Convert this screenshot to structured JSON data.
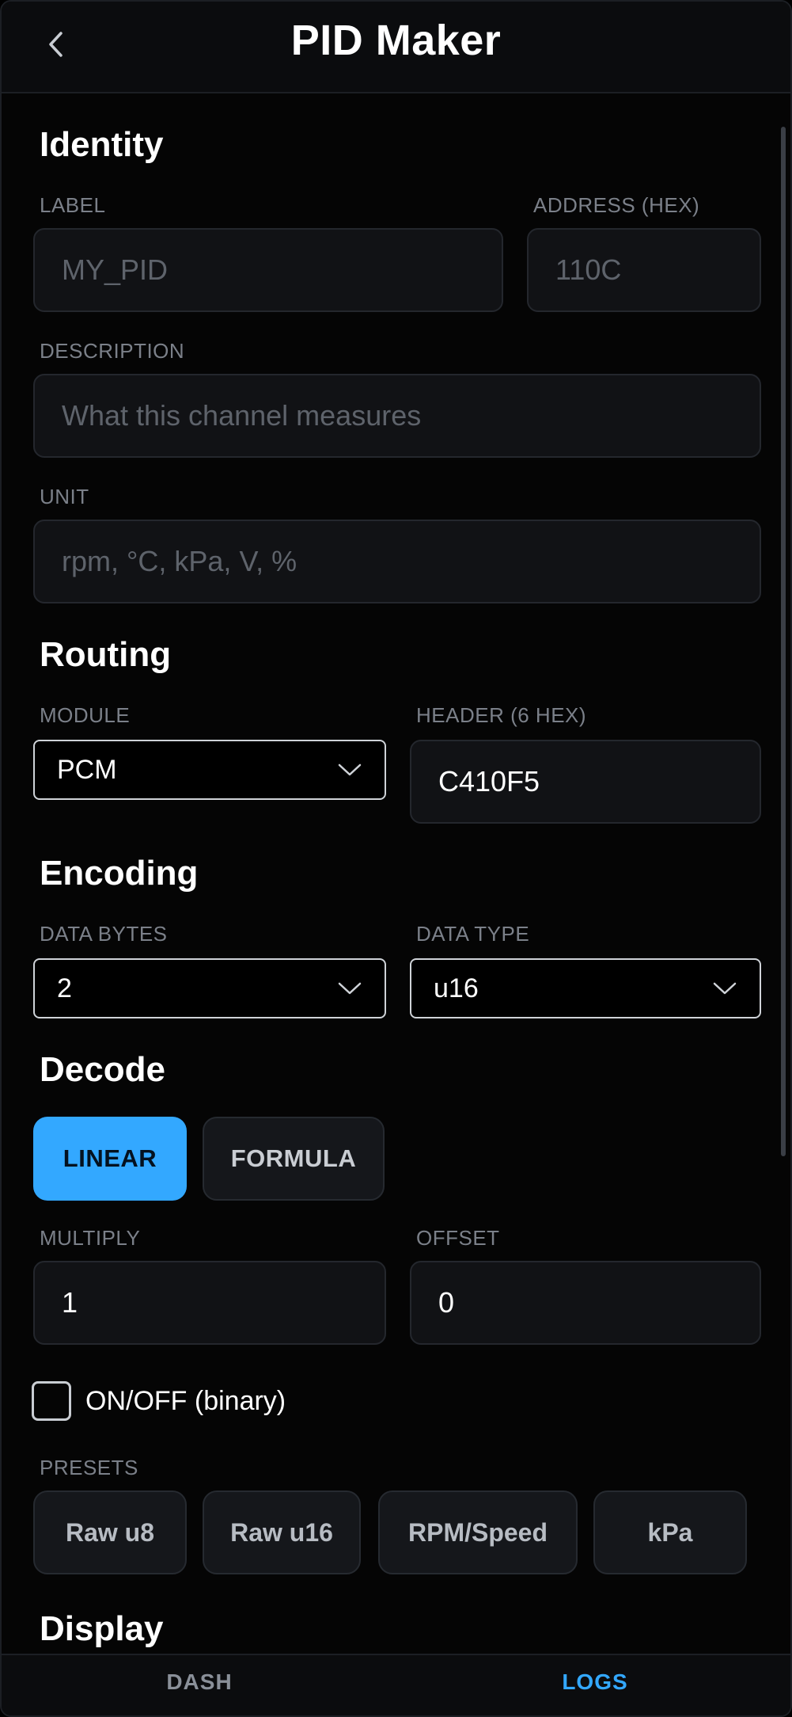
{
  "header": {
    "title": "PID Maker",
    "back_icon": "chevron-left-icon"
  },
  "identity": {
    "title": "Identity",
    "label_field": {
      "label": "LABEL",
      "placeholder": "MY_PID",
      "value": ""
    },
    "address_field": {
      "label": "ADDRESS (HEX)",
      "placeholder": "110C",
      "value": ""
    },
    "description_field": {
      "label": "DESCRIPTION",
      "placeholder": "What this channel measures",
      "value": ""
    },
    "unit_field": {
      "label": "UNIT",
      "placeholder": "rpm, °C, kPa, V, %",
      "value": ""
    }
  },
  "routing": {
    "title": "Routing",
    "module": {
      "label": "MODULE",
      "value": "PCM"
    },
    "header": {
      "label": "HEADER (6 HEX)",
      "value": "C410F5"
    }
  },
  "encoding": {
    "title": "Encoding",
    "data_bytes": {
      "label": "DATA BYTES",
      "value": "2"
    },
    "data_type": {
      "label": "DATA TYPE",
      "value": "u16"
    }
  },
  "decode": {
    "title": "Decode",
    "modes": [
      {
        "label": "LINEAR",
        "active": true
      },
      {
        "label": "FORMULA",
        "active": false
      }
    ],
    "multiply": {
      "label": "MULTIPLY",
      "value": "1"
    },
    "offset": {
      "label": "OFFSET",
      "value": "0"
    },
    "binary": {
      "label": "ON/OFF (binary)",
      "checked": false
    },
    "presets_label": "PRESETS",
    "presets": [
      "Raw u8",
      "Raw u16",
      "RPM/Speed",
      "kPa"
    ]
  },
  "display": {
    "title": "Display"
  },
  "bottom_nav": {
    "items": [
      {
        "label": "DASH",
        "active": false
      },
      {
        "label": "LOGS",
        "active": true
      }
    ]
  },
  "colors": {
    "accent": "#33a8ff",
    "background": "#050505",
    "input_bg": "#111215",
    "label": "#7b8089"
  }
}
